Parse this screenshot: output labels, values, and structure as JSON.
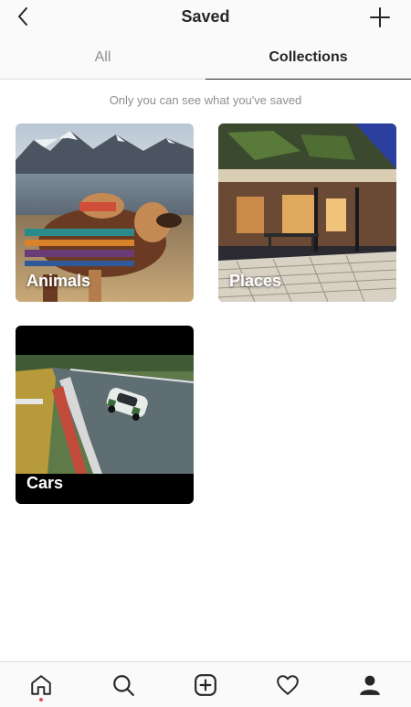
{
  "header": {
    "title": "Saved",
    "back_icon": "chevron-left-icon",
    "add_icon": "plus-icon"
  },
  "tabs": [
    {
      "label": "All",
      "active": false
    },
    {
      "label": "Collections",
      "active": true
    }
  ],
  "notice": "Only you can see what you've saved",
  "collections": [
    {
      "label": "Animals"
    },
    {
      "label": "Places"
    },
    {
      "label": "Cars"
    }
  ],
  "bottom_nav": [
    {
      "icon": "home-icon",
      "active": true
    },
    {
      "icon": "search-icon",
      "active": false
    },
    {
      "icon": "add-post-icon",
      "active": false
    },
    {
      "icon": "heart-icon",
      "active": false
    },
    {
      "icon": "profile-icon",
      "active": false
    }
  ],
  "colors": {
    "text": "#262626",
    "muted": "#8e8e8e",
    "border": "#dbdbdb",
    "notification_dot": "#ed4956"
  }
}
